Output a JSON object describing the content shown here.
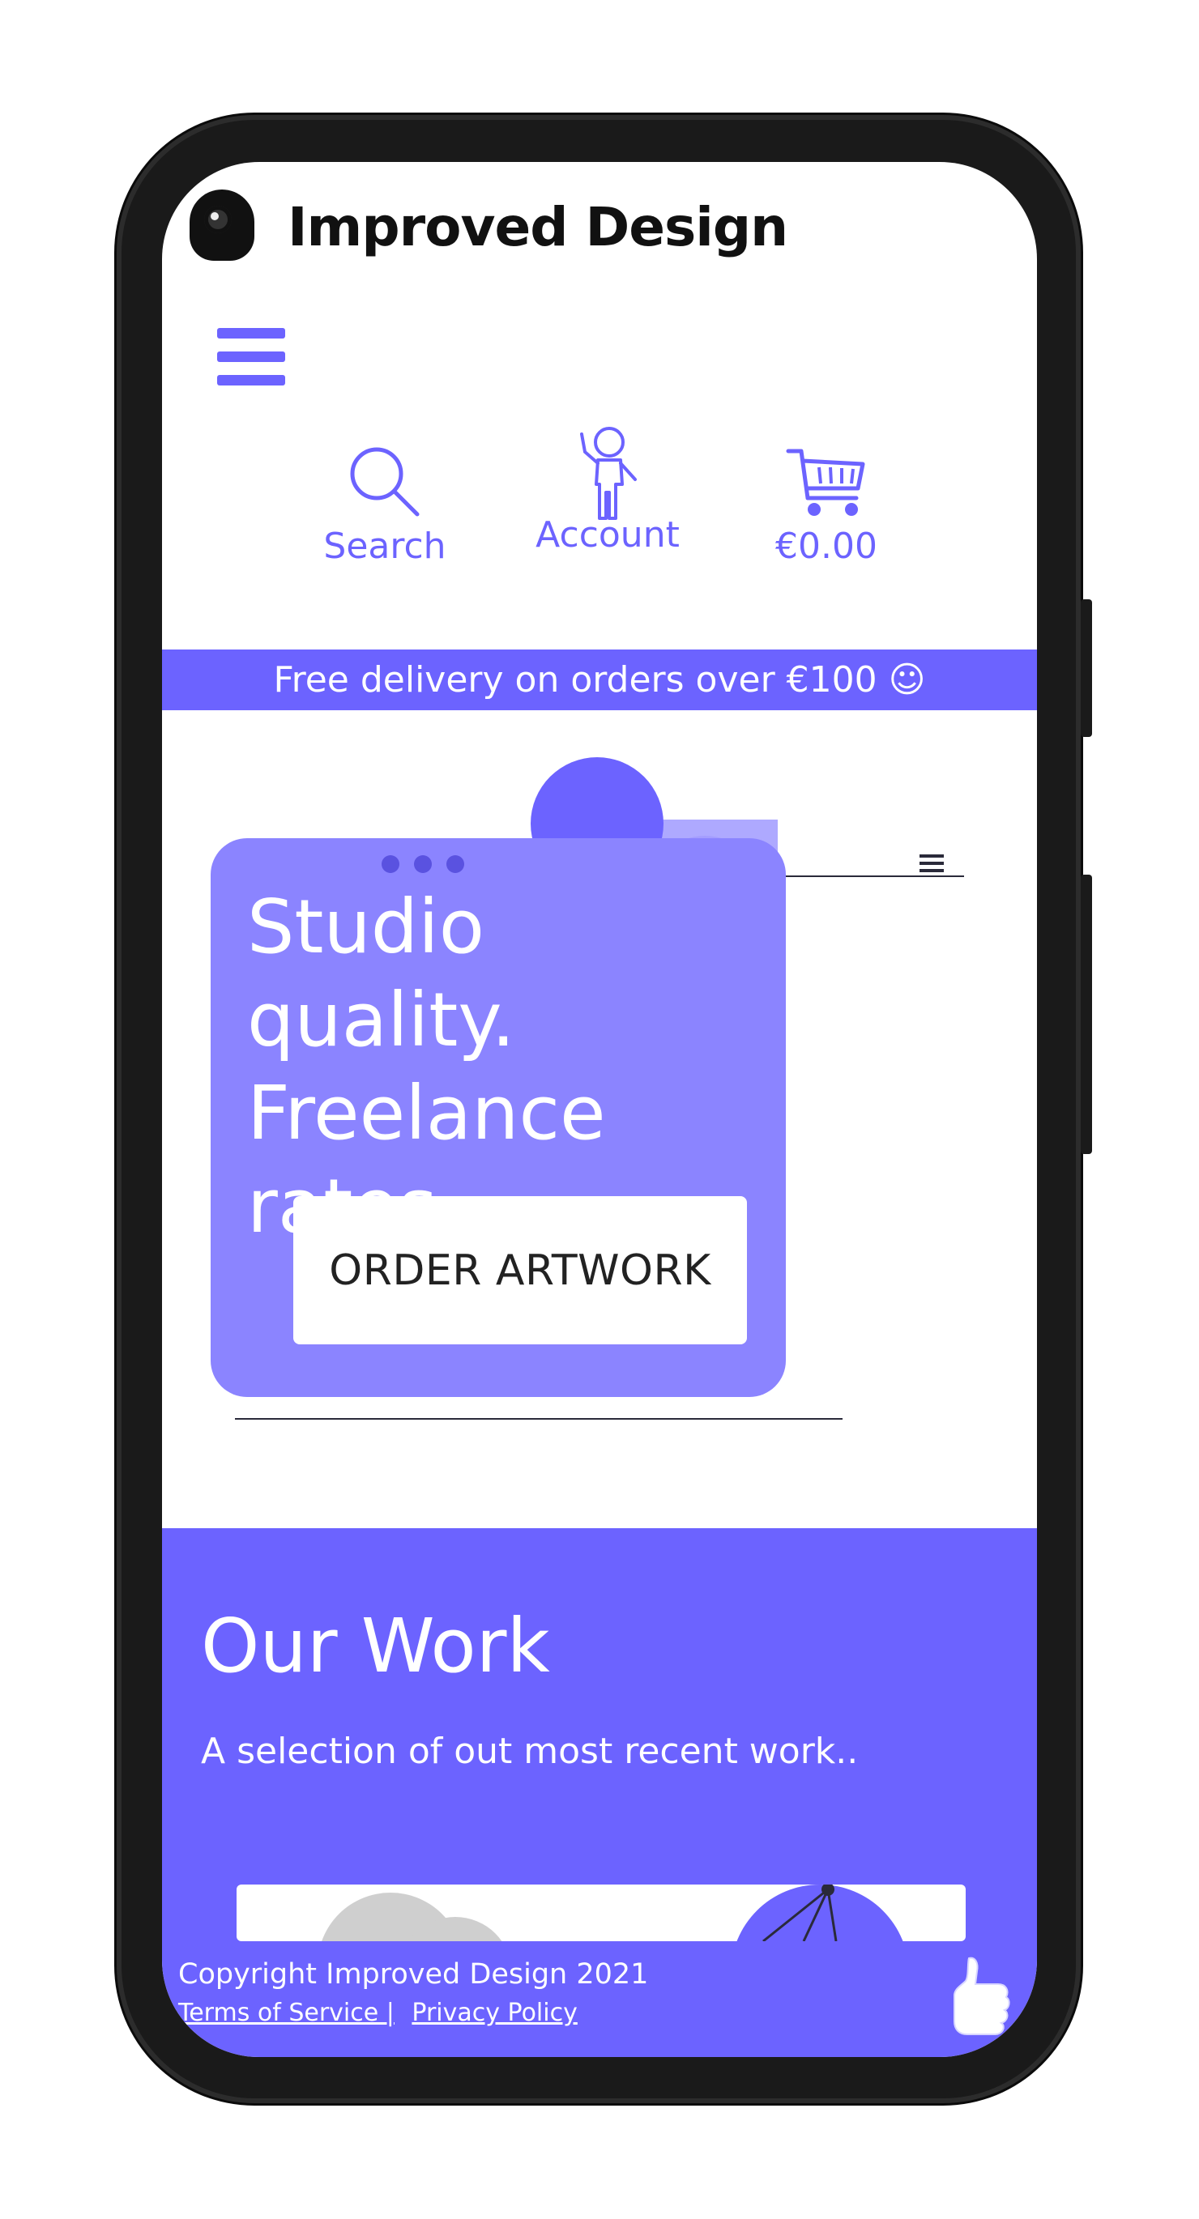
{
  "header": {
    "brand": "Improved Design"
  },
  "nav": {
    "search_label": "Search",
    "account_label": "Account",
    "cart_label": "€0.00"
  },
  "promo": {
    "text": "Free delivery on orders over €100 ☺"
  },
  "hero": {
    "title_line1": "Studio quality.",
    "title_line2": "Freelance",
    "title_line3": "rates.",
    "cta_label": "ORDER ARTWORK"
  },
  "work": {
    "title": "Our Work",
    "subtitle": "A selection of out most recent work.."
  },
  "footer": {
    "copyright": "Copyright Improved Design 2021",
    "terms_label": "Terms of Service |",
    "privacy_label": "Privacy Policy"
  },
  "colors": {
    "accent": "#6c63ff",
    "accent_light": "#8b84ff",
    "text_dark": "#111111"
  },
  "icons": [
    "camera-logo-icon",
    "hamburger-menu-icon",
    "search-icon",
    "account-icon",
    "cart-icon",
    "smile-icon",
    "thumbs-up-icon"
  ]
}
